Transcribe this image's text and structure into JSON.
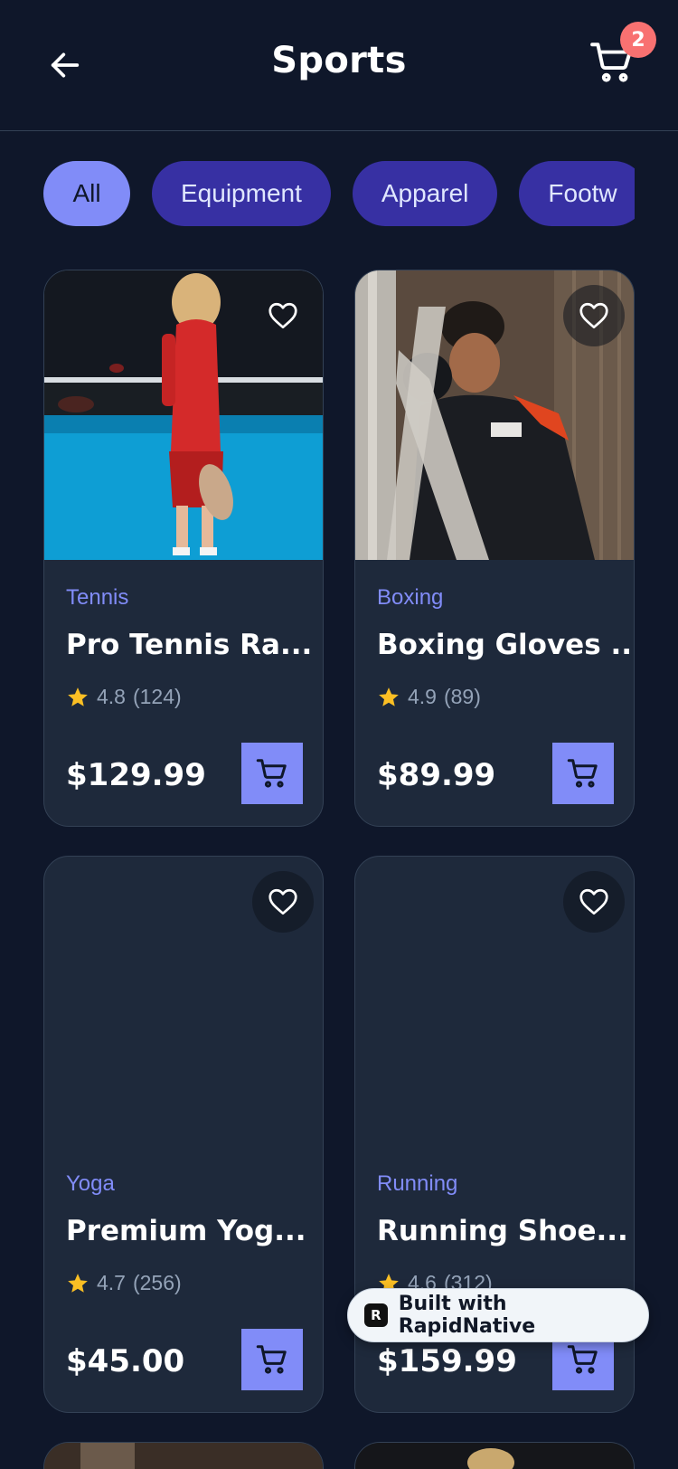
{
  "header": {
    "title": "Sports",
    "back_icon": "arrow-left-icon",
    "cart_icon": "cart-icon",
    "cart_count": "2"
  },
  "categories": {
    "items": [
      "All",
      "Equipment",
      "Apparel",
      "Footw"
    ],
    "active": "All"
  },
  "products": [
    {
      "category": "Tennis",
      "name": "Pro Tennis Ra...",
      "rating": "4.8",
      "reviews": "(124)",
      "price": "$129.99",
      "image": "photo-child-tennis"
    },
    {
      "category": "Boxing",
      "name": "Boxing Gloves ...",
      "rating": "4.9",
      "reviews": "(89)",
      "price": "$89.99",
      "image": "photo-boxer"
    },
    {
      "category": "Yoga",
      "name": "Premium Yog...",
      "rating": "4.7",
      "reviews": "(256)",
      "price": "$45.00",
      "image": ""
    },
    {
      "category": "Running",
      "name": "Running Shoe...",
      "rating": "4.6",
      "reviews": "(312)",
      "price": "$159.99",
      "image": ""
    }
  ],
  "badge": {
    "text": "Built with RapidNative",
    "logo": "R"
  },
  "colors": {
    "background": "#0f172a",
    "card": "#1e293b",
    "accent": "#818cf8",
    "chip": "#3730a3",
    "star": "#fbbf24",
    "badge": "#f87171"
  }
}
